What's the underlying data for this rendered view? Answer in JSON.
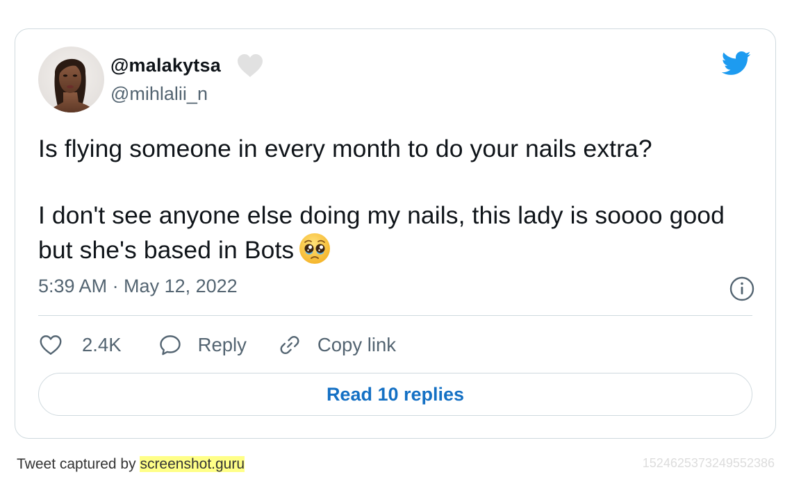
{
  "author": {
    "display_name": "@malakytsa",
    "handle": "@mihlalii_n"
  },
  "tweet": {
    "paragraph_1": "Is flying someone in every month to do your nails extra?",
    "paragraph_2": "I don't see anyone else doing my nails, this lady is soooo good but she's based in Bots",
    "timestamp": "5:39 AM · May 12, 2022"
  },
  "actions": {
    "likes": "2.4K",
    "reply_label": "Reply",
    "copy_link_label": "Copy link"
  },
  "read_replies_label": "Read 10 replies",
  "footer": {
    "captured_by": "Tweet captured by ",
    "brand": "screenshot.guru",
    "tweet_id": "1524625373249552386"
  },
  "colors": {
    "twitter_blue": "#1d9bf0",
    "link_blue": "#1470c4",
    "muted_text": "#536471",
    "border": "#cfd9de",
    "highlight": "#ffff88"
  },
  "icons": [
    "twitter-bird-icon",
    "heart-icon",
    "reply-bubble-icon",
    "link-icon",
    "info-icon",
    "pleading-face-emoji"
  ]
}
